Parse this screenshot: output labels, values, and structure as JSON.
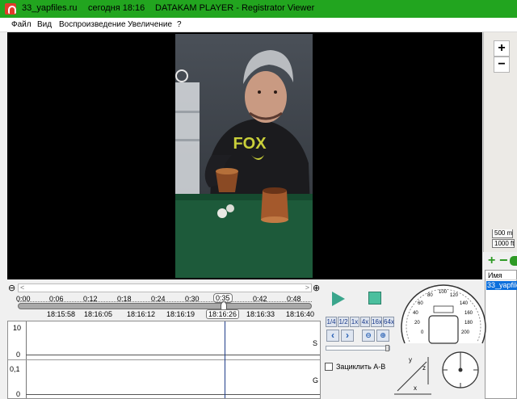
{
  "window": {
    "site": "33_yapfiles.ru",
    "date": "сегодня 18:16",
    "app_title": "DATAKAM PLAYER - Registrator Viewer",
    "accent_color": "#22a51f"
  },
  "menu": {
    "items": [
      "Файл",
      "Вид",
      "Воспроизведение",
      "Увеличение",
      "?"
    ]
  },
  "map": {
    "zoom_in": "+",
    "zoom_out": "−",
    "scale_m": "500 m",
    "scale_ft": "1000 ft"
  },
  "filelist": {
    "add": "+",
    "remove": "−",
    "header": "Имя",
    "items": [
      "33_yapfiles"
    ]
  },
  "timeline": {
    "ticks": [
      "0:00",
      "0:06",
      "0:12",
      "0:18",
      "0:24",
      "0:30",
      "0:36",
      "0:42",
      "0:48"
    ],
    "current": "0:35",
    "clock_times": [
      "18:15:58",
      "18:16:05",
      "18:16:12",
      "18:16:19",
      "18:16:26",
      "18:16:33",
      "18:16:40"
    ],
    "current_clock": "18:16:26",
    "position_fraction": 0.7
  },
  "graphs": {
    "s_label": "S",
    "s_max": "10",
    "s_min": "0",
    "g_label": "G",
    "g_max": "0,1",
    "g_min": "0"
  },
  "controls": {
    "speeds": [
      "1/4",
      "1/2",
      "1x",
      "4x",
      "16x",
      "64x"
    ],
    "loop_label": "Зациклить A-B",
    "play_color": "#3aa68c"
  },
  "speedometer": {
    "labels": [
      "0",
      "20",
      "40",
      "60",
      "80",
      "100",
      "120",
      "140",
      "160",
      "180",
      "200"
    ]
  },
  "axes": {
    "x": "x",
    "y": "y",
    "z": "z"
  }
}
